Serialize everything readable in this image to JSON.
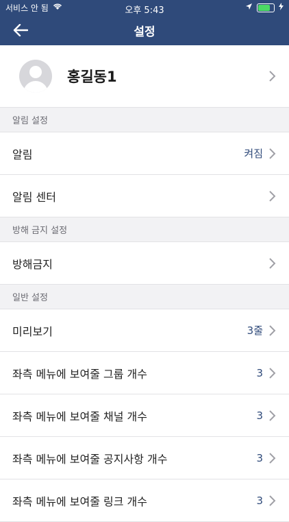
{
  "status": {
    "carrier": "서비스 안 됨",
    "time": "오후 5:43"
  },
  "nav": {
    "title": "설정"
  },
  "profile": {
    "name": "홍길동1"
  },
  "sections": {
    "notifications": {
      "header": "알림 설정",
      "alert_label": "알림",
      "alert_value": "켜짐",
      "center_label": "알림 센터"
    },
    "dnd": {
      "header": "방해 금지 설정",
      "dnd_label": "방해금지"
    },
    "general": {
      "header": "일반 설정",
      "preview_label": "미리보기",
      "preview_value": "3줄",
      "group_label": "좌측 메뉴에 보여줄 그룹 개수",
      "group_value": "3",
      "channel_label": "좌측 메뉴에 보여줄 채널 개수",
      "channel_value": "3",
      "notice_label": "좌측 메뉴에 보여줄 공지사항 개수",
      "notice_value": "3",
      "link_label": "좌측 메뉴에 보여줄 링크 개수",
      "link_value": "3"
    }
  },
  "colors": {
    "header_bg": "#2f4a7a",
    "accent": "#2f4a7a",
    "battery": "#4cd964"
  }
}
